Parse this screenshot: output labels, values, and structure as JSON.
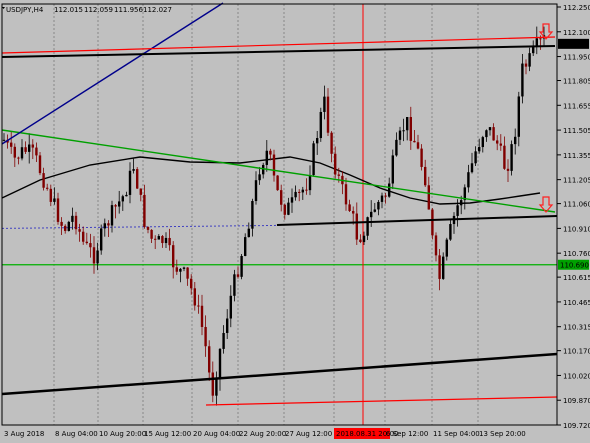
{
  "header": {
    "symbol": "USDJPY,H4",
    "open": "112.015",
    "high": "112.059",
    "low": "111.956",
    "close": "112.027"
  },
  "chart_data": {
    "type": "candlestick",
    "ylim": [
      109.72,
      112.25
    ],
    "grid": true,
    "y_ticks": [
      "112.250",
      "112.100",
      "111.950",
      "111.805",
      "111.655",
      "111.505",
      "111.355",
      "111.205",
      "111.060",
      "110.910",
      "110.760",
      "110.615",
      "110.465",
      "110.315",
      "110.170",
      "110.020",
      "109.870",
      "109.720"
    ],
    "x_ticks": [
      "3 Aug 2018",
      "8 Aug 04:00",
      "10 Aug 20:00",
      "15 Aug 12:00",
      "20 Aug 04:00",
      "22 Aug 20:00",
      "27 Aug 12:00",
      "2018.08.31 20:00",
      "6 Sep 12:00",
      "11 Sep 04:00",
      "13 Sep 20:00"
    ],
    "highlighted_x_label": "2018.08.31 20:00",
    "price_tags": [
      {
        "label": "112.027",
        "value": 112.027,
        "color": "#000000",
        "text_color": "#ffffff"
      },
      {
        "label": "110.690",
        "value": 110.69,
        "color": "#00a000",
        "text_color": "#c0ff70"
      }
    ],
    "horizontal_levels": [
      {
        "name": "support-green",
        "value": 110.69,
        "color": "#00b000"
      },
      {
        "name": "dotted-blue",
        "value": 110.91,
        "color": "#4040c0",
        "style": "dotted"
      }
    ],
    "vertical_marker": {
      "x_label": "2018.08.31 20:00",
      "color": "#ff0000"
    },
    "arrows": [
      {
        "name": "down-arrow-top",
        "color": "#ff2020"
      },
      {
        "name": "down-arrow-mid",
        "color": "#ff2020"
      }
    ],
    "colors": {
      "background": "#c0c0c0",
      "candle_up": "#000000",
      "candle_down": "#800000",
      "grid": "#888888",
      "moving_average": "#000000",
      "trend_green": "#00a000",
      "trend_blue": "#00008b",
      "trend_red": "#ff0000",
      "trend_black": "#000000"
    }
  }
}
